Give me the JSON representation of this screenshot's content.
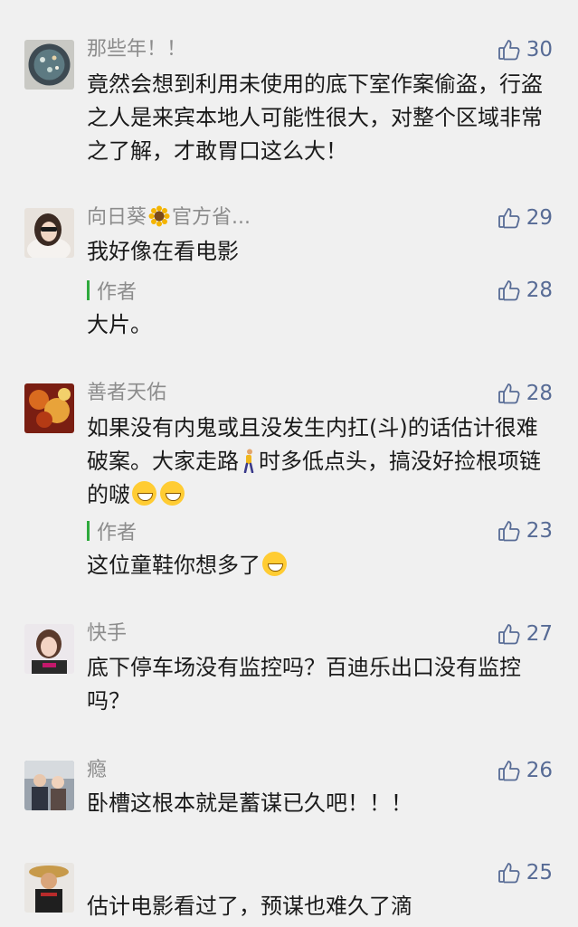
{
  "comments": [
    {
      "name": "那些年！！",
      "likes": "30",
      "text": "竟然会想到利用未使用的底下室作案偷盗，行盗之人是来宾本地人可能性很大，对整个区域非常之了解，才敢胃口这么大！"
    },
    {
      "name_a": "向日葵",
      "name_b": "官方省...",
      "likes": "29",
      "text": "我好像在看电影",
      "reply": {
        "label": "作者",
        "likes": "28",
        "text": "大片。"
      }
    },
    {
      "name": "善者天佑",
      "likes": "28",
      "text_a": "如果没有内鬼或且没发生内扛(斗)的话估计很难破案。大家走路",
      "text_b": "时多低点头，搞没好捡根项链的啵",
      "reply": {
        "label": "作者",
        "likes": "23",
        "text": "这位童鞋你想多了"
      }
    },
    {
      "name": "快手",
      "likes": "27",
      "text": "底下停车场没有监控吗？百迪乐出口没有监控吗？"
    },
    {
      "name": "瘾",
      "likes": "26",
      "text": "卧槽这根本就是蓄谋已久吧！！！"
    },
    {
      "name": "",
      "likes": "25",
      "text": "估计电影看过了，预谋也难久了滴"
    }
  ]
}
